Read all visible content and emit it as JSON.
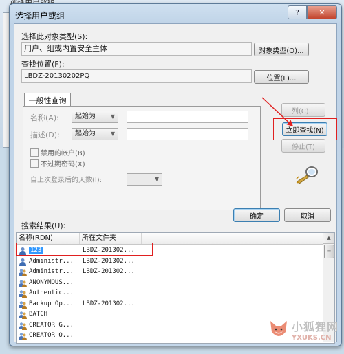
{
  "background_window": {
    "title": "选择用户或组"
  },
  "dialog": {
    "title": "选择用户或组",
    "help_label": "?",
    "close_label": "✕",
    "object_type_label": "选择此对象类型(S):",
    "object_type_value": "用户、组或内置安全主体",
    "object_type_button": "对象类型(O)...",
    "location_label": "查找位置(F):",
    "location_value": "LBDZ-20130202PQ",
    "location_button": "位置(L)...",
    "tab_label": "一般性查询",
    "name_label": "名称(A):",
    "name_combo": "起始为",
    "desc_label": "描述(D):",
    "desc_combo": "起始为",
    "disabled_accounts_label": "禁用的帐户(B)",
    "no_expire_pwd_label": "不过期密码(X)",
    "days_since_logon_label": "自上次登录后的天数(I):",
    "columns_button": "列(C)...",
    "find_now_button": "立即查找(N)",
    "stop_button": "停止(T)",
    "search_results_label": "搜索结果(U):",
    "ok_button": "确定",
    "cancel_button": "取消"
  },
  "results": {
    "columns": [
      "名称(RDN)",
      "所在文件夹"
    ],
    "rows": [
      {
        "name": "123",
        "folder": "LBDZ-201302...",
        "icon": "user-icon"
      },
      {
        "name": "Administr...",
        "folder": "LBDZ-201302...",
        "icon": "user-icon"
      },
      {
        "name": "Administr...",
        "folder": "LBDZ-201302...",
        "icon": "group-icon"
      },
      {
        "name": "ANONYMOUS...",
        "folder": "",
        "icon": "group-icon"
      },
      {
        "name": "Authentic...",
        "folder": "",
        "icon": "group-icon"
      },
      {
        "name": "Backup Op...",
        "folder": "LBDZ-201302...",
        "icon": "group-icon"
      },
      {
        "name": "BATCH",
        "folder": "",
        "icon": "group-icon"
      },
      {
        "name": "CREATOR G...",
        "folder": "",
        "icon": "group-icon"
      },
      {
        "name": "CREATOR O...",
        "folder": "",
        "icon": "group-icon"
      }
    ]
  },
  "watermark": {
    "text_cn": "小狐狸网",
    "text_en": "YXUKS.CN"
  },
  "colors": {
    "highlight_red": "#e02020",
    "selection": "#3399ff"
  }
}
